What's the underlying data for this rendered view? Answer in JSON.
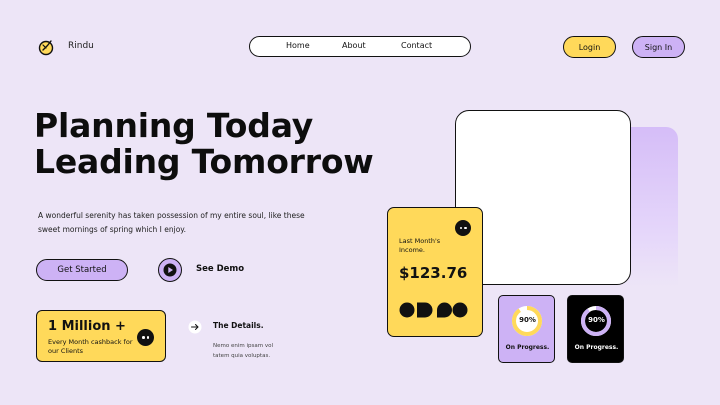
{
  "brand": {
    "name": "Rindu",
    "icon": "compass-logo-icon"
  },
  "nav": {
    "items": [
      {
        "label": "Home"
      },
      {
        "label": "About"
      },
      {
        "label": "Contact"
      }
    ]
  },
  "auth": {
    "login_label": "Login",
    "signin_label": "Sign In"
  },
  "hero": {
    "title_line1": "Planning Today",
    "title_line2": "Leading Tomorrow",
    "description": "A wonderful serenity has taken possession of my entire soul, like these sweet mornings of spring which I enjoy.",
    "cta_label": "Get Started",
    "demo_label": "See Demo"
  },
  "stat": {
    "value": "1 Million +",
    "caption": "Every Month cashback for our Clients"
  },
  "details": {
    "title": "The Details.",
    "text": "Nemo enim ipsam vol tatem quia voluptas."
  },
  "income_card": {
    "label": "Last Month's Income.",
    "value": "$123.76"
  },
  "progress_cards": [
    {
      "percent_text": "90%",
      "value": 0.9,
      "label": "On Progress."
    },
    {
      "percent_text": "90%",
      "value": 0.9,
      "label": "On Progress."
    }
  ],
  "colors": {
    "background": "#ede5f7",
    "yellow": "#ffd95a",
    "purple": "#cdb2f5",
    "dark": "#111111"
  }
}
